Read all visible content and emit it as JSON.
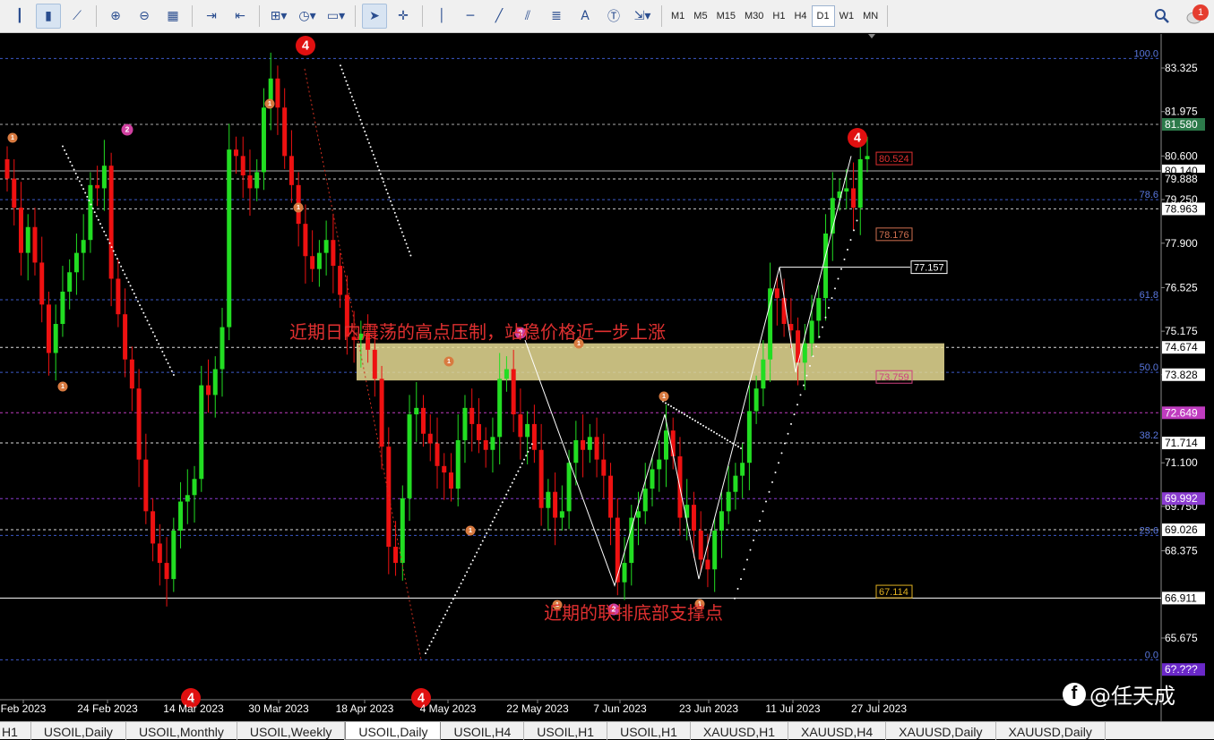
{
  "toolbar": {
    "left_icons": [
      "bar-chart-icon",
      "candlestick-icon",
      "line-chart-icon",
      "zoom-in-icon",
      "zoom-out-icon",
      "tile-windows-icon",
      "autoscroll-icon",
      "chart-shift-icon",
      "new-indicator-icon",
      "period-clock-icon",
      "templates-icon",
      "cursor-icon",
      "crosshair-icon",
      "vertical-line-icon",
      "horizontal-line-icon",
      "trendline-icon",
      "equidistant-channel-icon",
      "fibonacci-icon",
      "text-icon",
      "text-label-icon",
      "arrows-icon"
    ],
    "timeframes": [
      "M1",
      "M5",
      "M15",
      "M30",
      "H1",
      "H4",
      "D1",
      "W1",
      "MN"
    ],
    "active_timeframe": "D1",
    "notification_count": "1"
  },
  "chart": {
    "symbol": "USOIL,Daily",
    "price_ticks": [
      "83.325",
      "81.975",
      "80.600",
      "79.250",
      "77.900",
      "76.525",
      "75.175",
      "73.828",
      "71.100",
      "69.750",
      "68.375",
      "65.675"
    ],
    "date_ticks": [
      "Feb 2023",
      "24 Feb 2023",
      "14 Mar 2023",
      "30 Mar 2023",
      "18 Apr 2023",
      "4 May 2023",
      "22 May 2023",
      "7 Jun 2023",
      "23 Jun 2023",
      "11 Jul 2023",
      "27 Jul 2023"
    ],
    "price_labels": {
      "p81580": "81.580",
      "p80140": "80.140",
      "p79888": "79.888",
      "p78963": "78.963",
      "p74674": "74.674",
      "p73828": "73.828",
      "p72649": "72.649",
      "p71714": "71.714",
      "p69992": "69.992",
      "p69026": "69.026",
      "p66911": "66.911",
      "p_bottom": "6?.???"
    },
    "fib_levels": [
      "100.0",
      "78.6",
      "61.8",
      "50.0",
      "38.2",
      "23.6",
      "0.0"
    ],
    "boxed_labels": {
      "b80524": "80.524",
      "b78176": "78.176",
      "b77157": "77.157",
      "b73759": "73.759",
      "b67114": "67.114"
    },
    "annotations": {
      "resistance_text": "近期日内震荡的高点压制，站稳价格近一步上涨",
      "support_text": "近期的联排底部支撑点"
    },
    "wave_markers": {
      "big4": "4",
      "m1": "1",
      "m2": "2"
    },
    "colors": {
      "bull": "#22dd22",
      "bear": "#ee1111",
      "zone": "#e8dc94",
      "label_text": "#e03030"
    }
  },
  "tabs": [
    "H1",
    "USOIL,Daily",
    "USOIL,Monthly",
    "USOIL,Weekly",
    "USOIL,Daily",
    "USOIL,H4",
    "USOIL,H1",
    "USOIL,H1",
    "XAUUSD,H1",
    "XAUUSD,H4",
    "XAUUSD,Daily",
    "XAUUSD,Daily"
  ],
  "active_tab_index": 4,
  "watermark": {
    "icon": "facebook-icon",
    "text": "@任天成"
  }
}
